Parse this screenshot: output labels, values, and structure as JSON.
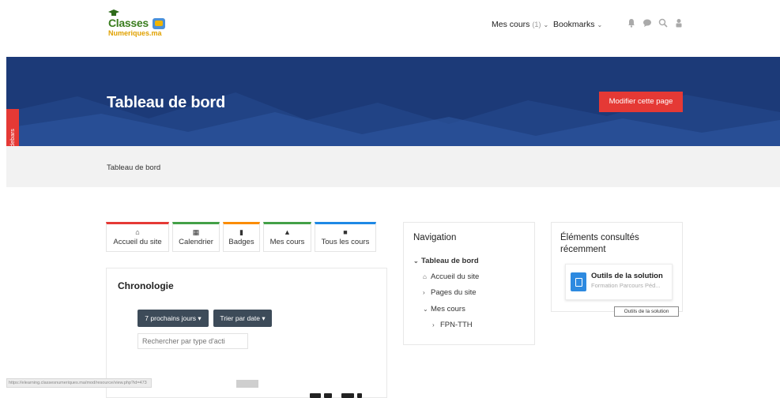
{
  "brand": {
    "line1": "Classes",
    "line2": "Numeriques.ma"
  },
  "topnav": {
    "mes_cours": "Mes cours",
    "mes_cours_count": "(1)",
    "bookmarks": "Bookmarks",
    "icons": [
      "bell-icon",
      "chat-icon",
      "search-icon",
      "user-icon"
    ]
  },
  "hero": {
    "title": "Tableau de bord",
    "edit_button": "Modifier cette page",
    "colors": {
      "banner": "#1c3a78",
      "button": "#e53935"
    }
  },
  "sidebar_toggle": "Hide sidebars",
  "breadcrumb": "Tableau de bord",
  "quick_links": [
    {
      "label": "Accueil du site",
      "icon": "home-icon",
      "color": "#e53935"
    },
    {
      "label": "Calendrier",
      "icon": "calendar-icon",
      "color": "#43a047"
    },
    {
      "label": "Badges",
      "icon": "bookmark-icon",
      "color": "#fb8c00"
    },
    {
      "label": "Mes cours",
      "icon": "graduation-cap-icon",
      "color": "#43a047"
    },
    {
      "label": "Tous les cours",
      "icon": "archive-icon",
      "color": "#1e88e5"
    }
  ],
  "chronologie": {
    "title": "Chronologie",
    "filter_days": "7 prochains jours",
    "sort": "Trier par date",
    "search_placeholder": "Rechercher par type d'acti"
  },
  "navigation": {
    "title": "Navigation",
    "items": [
      "Tableau de bord",
      "Accueil du site",
      "Pages du site",
      "Mes cours",
      "FPN-TTH"
    ]
  },
  "recent": {
    "title": "Éléments consultés récemment",
    "item_title": "Outils de la solution",
    "item_sub": "Formation Parcours Péd...",
    "tooltip": "Outils de la solution"
  },
  "status_url": "https://elearning.classesnumeriques.ma/mod/resource/view.php?id=473"
}
